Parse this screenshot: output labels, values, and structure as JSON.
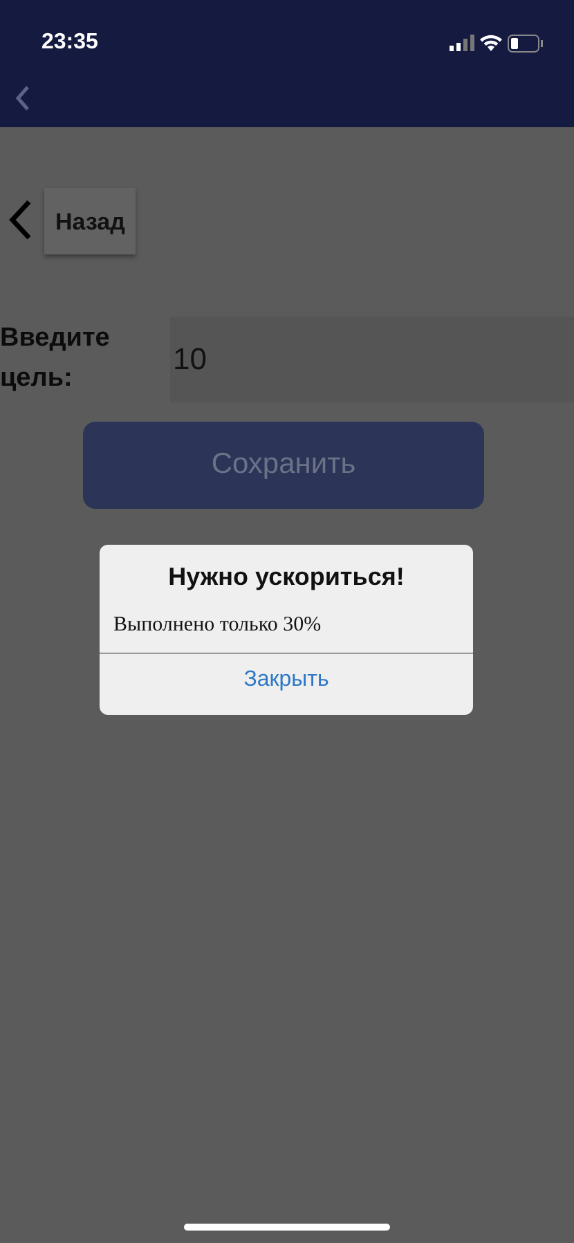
{
  "status_bar": {
    "time": "23:35"
  },
  "back_button": {
    "label": "Назад"
  },
  "goal": {
    "label": "Введите цель:",
    "value": "10"
  },
  "save_button": {
    "label": "Сохранить"
  },
  "alert": {
    "title": "Нужно ускориться!",
    "message": "Выполнено только 30%",
    "button": "Закрыть"
  }
}
